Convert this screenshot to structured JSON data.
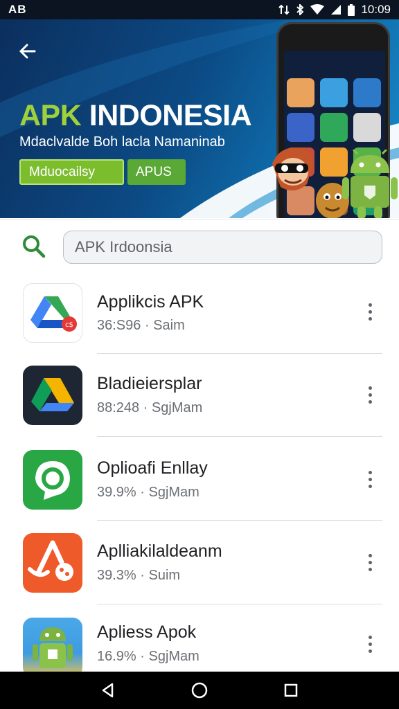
{
  "status_bar": {
    "left_text": "AB",
    "time": "10:09",
    "icons": [
      "data-arrows-icon",
      "bluetooth-icon",
      "wifi-icon",
      "signal-icon",
      "battery-icon"
    ]
  },
  "banner": {
    "title_part1": "APK",
    "title_part2": " INDONESIA",
    "subtitle": "Mdaclvalde Boh lacla Namaninab",
    "chip_1": "Mduocailsy",
    "chip_2": "APUS",
    "colors": {
      "accent_green": "#9ed13a",
      "chip_green": "#7cbd2e",
      "banner_blue": "#0c4a84"
    }
  },
  "search": {
    "value": "APK Irdoonsia",
    "placeholder": ""
  },
  "apps": [
    {
      "name": "Applikcis APK",
      "meta": "36:S96 · Saim",
      "icon": "drive-red-badge-icon"
    },
    {
      "name": "Bladieiersplar",
      "meta": "88:248 · SgjMam",
      "icon": "drive-dark-icon"
    },
    {
      "name": "Oplioafi Enllay",
      "meta": "39.9% · SgjMam",
      "icon": "whatsapp-like-icon"
    },
    {
      "name": "Aplliakilaldeanm",
      "meta": "39.3% · Suim",
      "icon": "orange-game-icon"
    },
    {
      "name": "Apliess Apok",
      "meta": "16.9% · SgjMam",
      "icon": "android-icon"
    }
  ],
  "nav": [
    "back-nav-icon",
    "home-nav-icon",
    "recents-nav-icon"
  ]
}
